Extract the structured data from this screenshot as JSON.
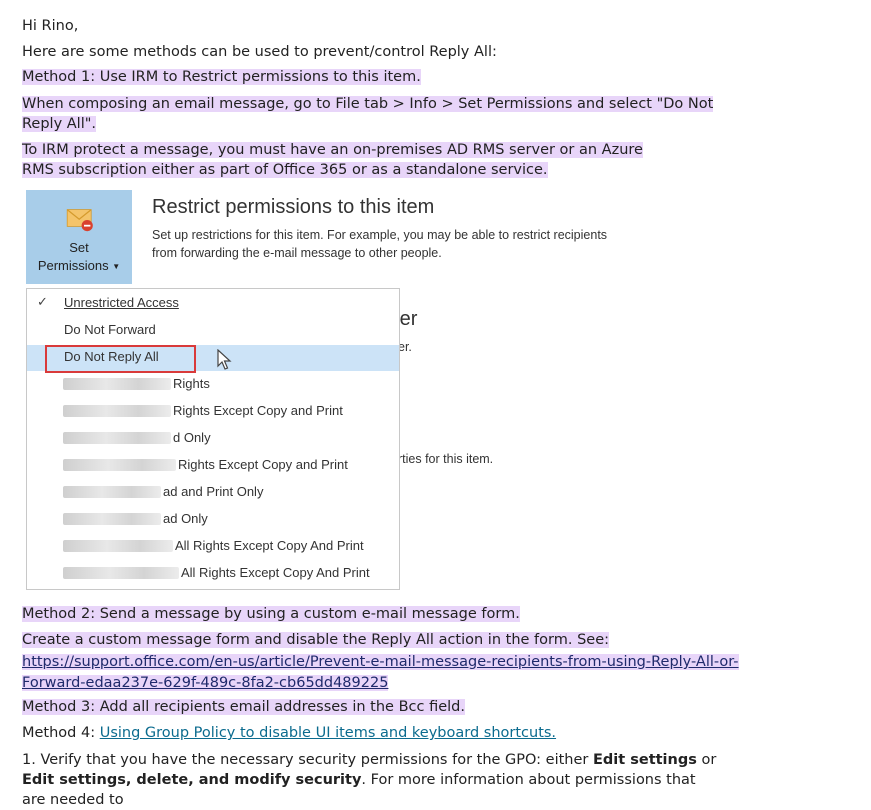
{
  "greeting": "Hi Rino,",
  "intro": "Here are some methods can be used to prevent/control Reply All:",
  "method1": {
    "title": "Method 1: Use IRM to Restrict permissions to this item.",
    "step": "When composing an email message, go to File tab > Info > Set Permissions and select \"Do Not Reply All\".",
    "note": "To IRM protect a message, you must have an on-premises AD RMS server or an Azure RMS subscription either as part of Office 365 or as a standalone service."
  },
  "screenshot": {
    "button_line1": "Set",
    "button_line2": "Permissions",
    "panel_title": "Restrict permissions to this item",
    "panel_desc_1": "Set up restrictions for this item. For example, you may be able to restrict recipients",
    "panel_desc_2": "from forwarding the e-mail message to other people.",
    "bg_fragment_1": "lder",
    "bg_fragment_2": "er.",
    "bg_fragment_3": "rties for this item.",
    "menu_items": [
      "Unrestricted Access",
      "Do Not Forward",
      "Do Not Reply All",
      "Rights",
      "Rights Except Copy and Print",
      "d Only",
      "Rights Except Copy and Print",
      "ad and Print Only",
      "ad Only",
      "All Rights Except Copy And Print",
      "All Rights Except Copy And Print"
    ],
    "colors": {
      "button_bg": "#a8cde9",
      "selected_bg": "#cce3f7",
      "highlight_box": "#d93a3a"
    }
  },
  "method2": {
    "title": "Method 2: Send a message by using a custom e-mail message form.",
    "step": "Create a custom message form and disable the Reply All action in the form. See:",
    "link_line1": "https://support.office.com/en-us/article/Prevent-e-mail-message-recipients-from-using-Reply-All-or-",
    "link_line2": "Forward-edaa237e-629f-489c-8fa2-cb65dd489225"
  },
  "method3": {
    "title": "Method 3: Add all recipients email addresses in the Bcc field."
  },
  "method4": {
    "prefix": "Method 4: ",
    "link": "Using Group Policy to disable UI items and keyboard shortcuts."
  },
  "step1": {
    "part1": "1. Verify that you have the necessary security permissions for the GPO: either ",
    "bold1": "Edit settings",
    "part2": " or ",
    "bold2": "Edit settings, delete, and modify security",
    "part3": ". For more information about permissions that are needed to"
  },
  "colors": {
    "highlight": "#e8d5f9",
    "link": "#0b6b8e"
  }
}
